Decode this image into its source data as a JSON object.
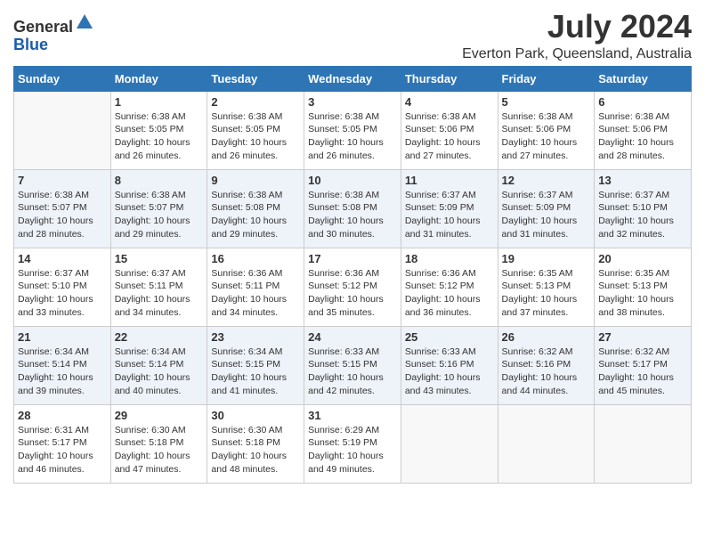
{
  "header": {
    "logo_general": "General",
    "logo_blue": "Blue",
    "month": "July 2024",
    "location": "Everton Park, Queensland, Australia"
  },
  "days_of_week": [
    "Sunday",
    "Monday",
    "Tuesday",
    "Wednesday",
    "Thursday",
    "Friday",
    "Saturday"
  ],
  "weeks": [
    [
      {
        "day": "",
        "info": ""
      },
      {
        "day": "1",
        "info": "Sunrise: 6:38 AM\nSunset: 5:05 PM\nDaylight: 10 hours\nand 26 minutes."
      },
      {
        "day": "2",
        "info": "Sunrise: 6:38 AM\nSunset: 5:05 PM\nDaylight: 10 hours\nand 26 minutes."
      },
      {
        "day": "3",
        "info": "Sunrise: 6:38 AM\nSunset: 5:05 PM\nDaylight: 10 hours\nand 26 minutes."
      },
      {
        "day": "4",
        "info": "Sunrise: 6:38 AM\nSunset: 5:06 PM\nDaylight: 10 hours\nand 27 minutes."
      },
      {
        "day": "5",
        "info": "Sunrise: 6:38 AM\nSunset: 5:06 PM\nDaylight: 10 hours\nand 27 minutes."
      },
      {
        "day": "6",
        "info": "Sunrise: 6:38 AM\nSunset: 5:06 PM\nDaylight: 10 hours\nand 28 minutes."
      }
    ],
    [
      {
        "day": "7",
        "info": "Sunrise: 6:38 AM\nSunset: 5:07 PM\nDaylight: 10 hours\nand 28 minutes."
      },
      {
        "day": "8",
        "info": "Sunrise: 6:38 AM\nSunset: 5:07 PM\nDaylight: 10 hours\nand 29 minutes."
      },
      {
        "day": "9",
        "info": "Sunrise: 6:38 AM\nSunset: 5:08 PM\nDaylight: 10 hours\nand 29 minutes."
      },
      {
        "day": "10",
        "info": "Sunrise: 6:38 AM\nSunset: 5:08 PM\nDaylight: 10 hours\nand 30 minutes."
      },
      {
        "day": "11",
        "info": "Sunrise: 6:37 AM\nSunset: 5:09 PM\nDaylight: 10 hours\nand 31 minutes."
      },
      {
        "day": "12",
        "info": "Sunrise: 6:37 AM\nSunset: 5:09 PM\nDaylight: 10 hours\nand 31 minutes."
      },
      {
        "day": "13",
        "info": "Sunrise: 6:37 AM\nSunset: 5:10 PM\nDaylight: 10 hours\nand 32 minutes."
      }
    ],
    [
      {
        "day": "14",
        "info": "Sunrise: 6:37 AM\nSunset: 5:10 PM\nDaylight: 10 hours\nand 33 minutes."
      },
      {
        "day": "15",
        "info": "Sunrise: 6:37 AM\nSunset: 5:11 PM\nDaylight: 10 hours\nand 34 minutes."
      },
      {
        "day": "16",
        "info": "Sunrise: 6:36 AM\nSunset: 5:11 PM\nDaylight: 10 hours\nand 34 minutes."
      },
      {
        "day": "17",
        "info": "Sunrise: 6:36 AM\nSunset: 5:12 PM\nDaylight: 10 hours\nand 35 minutes."
      },
      {
        "day": "18",
        "info": "Sunrise: 6:36 AM\nSunset: 5:12 PM\nDaylight: 10 hours\nand 36 minutes."
      },
      {
        "day": "19",
        "info": "Sunrise: 6:35 AM\nSunset: 5:13 PM\nDaylight: 10 hours\nand 37 minutes."
      },
      {
        "day": "20",
        "info": "Sunrise: 6:35 AM\nSunset: 5:13 PM\nDaylight: 10 hours\nand 38 minutes."
      }
    ],
    [
      {
        "day": "21",
        "info": "Sunrise: 6:34 AM\nSunset: 5:14 PM\nDaylight: 10 hours\nand 39 minutes."
      },
      {
        "day": "22",
        "info": "Sunrise: 6:34 AM\nSunset: 5:14 PM\nDaylight: 10 hours\nand 40 minutes."
      },
      {
        "day": "23",
        "info": "Sunrise: 6:34 AM\nSunset: 5:15 PM\nDaylight: 10 hours\nand 41 minutes."
      },
      {
        "day": "24",
        "info": "Sunrise: 6:33 AM\nSunset: 5:15 PM\nDaylight: 10 hours\nand 42 minutes."
      },
      {
        "day": "25",
        "info": "Sunrise: 6:33 AM\nSunset: 5:16 PM\nDaylight: 10 hours\nand 43 minutes."
      },
      {
        "day": "26",
        "info": "Sunrise: 6:32 AM\nSunset: 5:16 PM\nDaylight: 10 hours\nand 44 minutes."
      },
      {
        "day": "27",
        "info": "Sunrise: 6:32 AM\nSunset: 5:17 PM\nDaylight: 10 hours\nand 45 minutes."
      }
    ],
    [
      {
        "day": "28",
        "info": "Sunrise: 6:31 AM\nSunset: 5:17 PM\nDaylight: 10 hours\nand 46 minutes."
      },
      {
        "day": "29",
        "info": "Sunrise: 6:30 AM\nSunset: 5:18 PM\nDaylight: 10 hours\nand 47 minutes."
      },
      {
        "day": "30",
        "info": "Sunrise: 6:30 AM\nSunset: 5:18 PM\nDaylight: 10 hours\nand 48 minutes."
      },
      {
        "day": "31",
        "info": "Sunrise: 6:29 AM\nSunset: 5:19 PM\nDaylight: 10 hours\nand 49 minutes."
      },
      {
        "day": "",
        "info": ""
      },
      {
        "day": "",
        "info": ""
      },
      {
        "day": "",
        "info": ""
      }
    ]
  ]
}
